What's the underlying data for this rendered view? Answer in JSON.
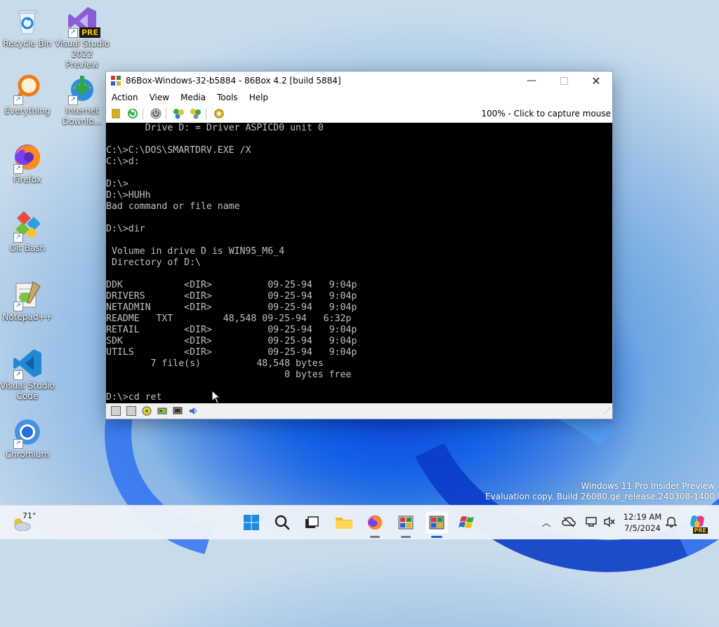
{
  "desktop": {
    "icons": [
      {
        "label": "Recycle Bin"
      },
      {
        "label": "Visual Studio 2022 Preview",
        "badge": "PRE"
      },
      {
        "label": "Everything"
      },
      {
        "label": "Internet Downlo..."
      },
      {
        "label": "Firefox"
      },
      {
        "label": "Git Bash"
      },
      {
        "label": "Notepad++"
      },
      {
        "label": "Visual Studio Code"
      },
      {
        "label": "Chromium"
      }
    ]
  },
  "window": {
    "title": "86Box-Windows-32-b5884 - 86Box 4.2 [build 5884]",
    "menu": [
      "Action",
      "View",
      "Media",
      "Tools",
      "Help"
    ],
    "toolbar_status": "100% - Click to capture mouse",
    "console_lines": [
      "       Drive D: = Driver ASPICD0 unit 0",
      "",
      "C:\\>C:\\DOS\\SMARTDRV.EXE /X",
      "C:\\>d:",
      "",
      "D:\\>",
      "D:\\>HUHh",
      "Bad command or file name",
      "",
      "D:\\>dir",
      "",
      " Volume in drive D is WIN95_M6_4",
      " Directory of D:\\",
      "",
      "DDK           <DIR>          09-25-94   9:04p",
      "DRIVERS       <DIR>          09-25-94   9:04p",
      "NETADMIN      <DIR>          09-25-94   9:04p",
      "README   TXT         48,548 09-25-94   6:32p",
      "RETAIL        <DIR>          09-25-94   9:04p",
      "SDK           <DIR>          09-25-94   9:04p",
      "UTILS         <DIR>          09-25-94   9:04p",
      "        7 file(s)          48,548 bytes",
      "                                0 bytes free",
      "",
      "D:\\>cd ret"
    ]
  },
  "watermark": {
    "line1": "Windows 11 Pro Insider Preview",
    "line2": "Evaluation copy. Build 26080.ge_release.240308-1400"
  },
  "taskbar": {
    "weather_temp": "71°",
    "clock_time": "12:19 AM",
    "clock_date": "7/5/2024",
    "copilot_badge": "PRE"
  },
  "colors": {
    "console_text": "#c0c0c0",
    "console_bg": "#000000",
    "accent": "#1c67d8"
  }
}
